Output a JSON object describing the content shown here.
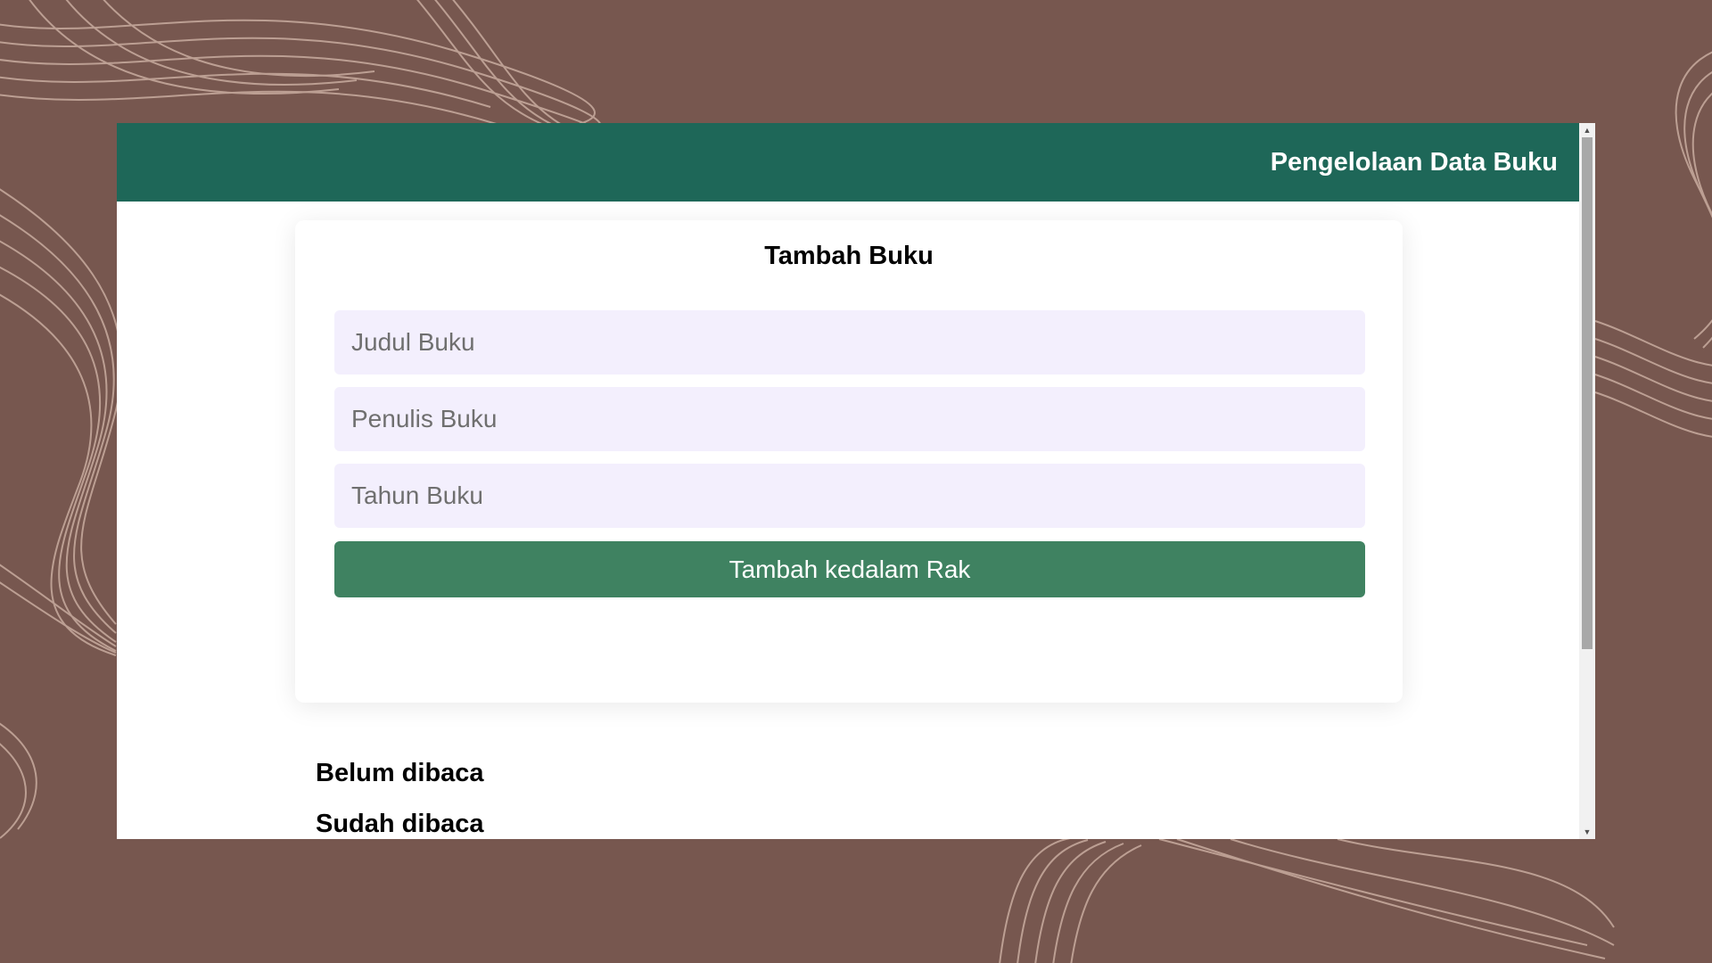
{
  "header": {
    "title": "Pengelolaan Data Buku"
  },
  "form": {
    "title": "Tambah Buku",
    "title_placeholder": "Judul Buku",
    "author_placeholder": "Penulis Buku",
    "year_placeholder": "Tahun Buku",
    "submit_label": "Tambah kedalam Rak"
  },
  "shelves": {
    "unread_label": "Belum dibaca",
    "read_label": "Sudah dibaca"
  },
  "colors": {
    "background": "#77574f",
    "header": "#1e6758",
    "button": "#3f8261",
    "input_bg": "#f3effd",
    "decor_lines": "#c4a79b"
  },
  "icons": {
    "scroll_up": "scroll-up-arrow-icon",
    "scroll_down": "scroll-down-arrow-icon"
  }
}
